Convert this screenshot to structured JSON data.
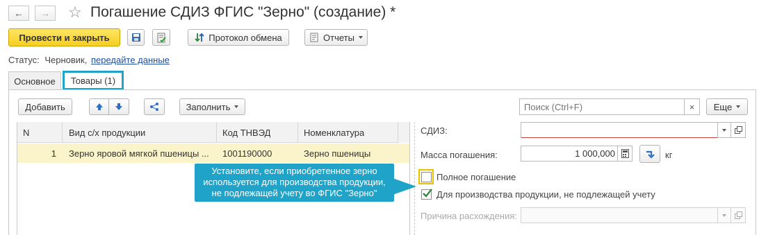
{
  "window": {
    "title": "Погашение СДИЗ ФГИС \"Зерно\" (создание) *"
  },
  "toolbar": {
    "post_close_label": "Провести и закрыть",
    "exchange_protocol_label": "Протокол обмена",
    "reports_label": "Отчеты"
  },
  "status": {
    "label": "Статус:",
    "value": "Черновик,",
    "link": "передайте данные"
  },
  "tabs": [
    {
      "label": "Основное"
    },
    {
      "label": "Товары (1)"
    }
  ],
  "grid_toolbar": {
    "add_label": "Добавить",
    "fill_label": "Заполнить",
    "search_placeholder": "Поиск (Ctrl+F)",
    "more_label": "Еще"
  },
  "grid": {
    "columns": [
      "N",
      "Вид с/х продукции",
      "Код ТНВЭД",
      "Номенклатура"
    ],
    "rows": [
      [
        "1",
        "Зерно яровой мягкой пшеницы ...",
        "1001190000",
        "Зерно пшеницы"
      ]
    ]
  },
  "details": {
    "sdiz_label": "СДИЗ:",
    "sdiz_value": "",
    "mass_label": "Масса погашения:",
    "mass_value": "1 000,000",
    "mass_unit": "кг",
    "full_repayment_label": "Полное погашение",
    "full_repayment_checked": false,
    "production_label": "Для производства продукции, не подлежащей учету",
    "production_checked": true,
    "reason_label": "Причина расхождения:",
    "reason_value": ""
  },
  "tooltip": {
    "line1": "Установите, если приобретенное зерно",
    "line2": "используется для производства продукции,",
    "line3": "не подлежащей учету во ФГИС \"Зерно\""
  },
  "colors": {
    "primary_button": "#f5cf1f",
    "selected_row": "#fbf3c9",
    "tooltip_bg": "#1fa3c8",
    "highlight_border": "#1fa3c8",
    "link": "#1f4e9c",
    "required_underline": "#d04040"
  }
}
